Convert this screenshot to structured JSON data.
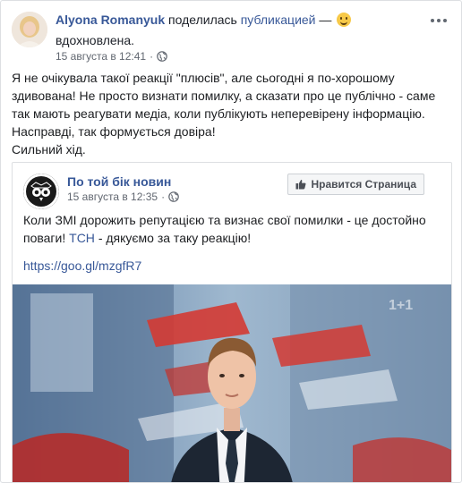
{
  "post": {
    "author": "Alyona Romanyuk",
    "action": "поделилась",
    "action_link": "публикацией",
    "dash": "—",
    "feeling": "вдохновлена.",
    "timestamp": "15 августа в 12:41",
    "text_lines": [
      "Я не очікувала такої реакції \"плюсів\", але сьогодні я по-хорошому",
      "здивована! Не просто визнати помилку, а сказати про це публічно - саме",
      "так мають реагувати медіа, коли публікують неперевірену інформацію.",
      "Насправді, так формується довіра!",
      "Сильний хід."
    ]
  },
  "shared": {
    "page_name": "По той бік новин",
    "timestamp": "15 августа в 12:35",
    "like_button": "Нравится Страница",
    "text_part1": "Коли ЗМІ дорожить репутацією та визнає свої помилки - це достойно поваги!",
    "tsn": "ТСН",
    "text_part2": "- дякуємо за таку реакцію!",
    "link": "https://goo.gl/mzgfR7"
  },
  "colors": {
    "link_blue": "#385898",
    "text": "#1c1e21",
    "meta_gray": "#616770",
    "border": "#dddfe2"
  },
  "icons": {
    "more": "more-options-icon",
    "globe": "globe-icon",
    "thumb": "thumbs-up-icon",
    "feeling": "smiling-emoji-icon"
  }
}
